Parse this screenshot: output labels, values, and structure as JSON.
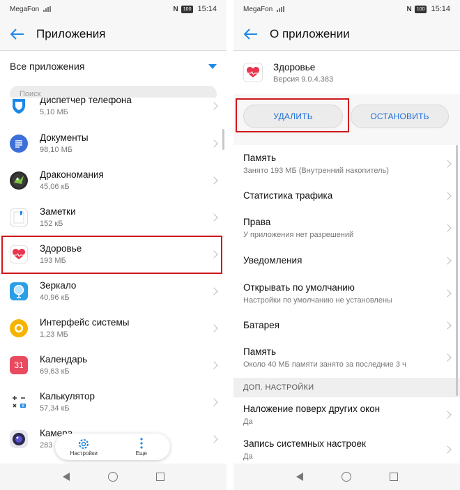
{
  "status": {
    "carrier": "MegaFon",
    "nfc": "N",
    "battery": "100",
    "time": "15:14"
  },
  "left": {
    "title": "Приложения",
    "filter": "Все приложения",
    "search_placeholder": "Поиск",
    "apps": [
      {
        "name": "Диспетчер телефона",
        "size": "5,10 МБ",
        "icon": "phone-manager-icon"
      },
      {
        "name": "Документы",
        "size": "98,10 МБ",
        "icon": "documents-icon"
      },
      {
        "name": "Дракономания",
        "size": "45,06 кБ",
        "icon": "dragon-game-icon"
      },
      {
        "name": "Заметки",
        "size": "152 кБ",
        "icon": "notes-icon"
      },
      {
        "name": "Здоровье",
        "size": "193 МБ",
        "icon": "health-heart-icon"
      },
      {
        "name": "Зеркало",
        "size": "40,96 кБ",
        "icon": "mirror-icon"
      },
      {
        "name": "Интерфейс системы",
        "size": "1,23 МБ",
        "icon": "system-ui-icon"
      },
      {
        "name": "Календарь",
        "size": "69,63 кБ",
        "icon": "calendar-icon",
        "badge": "31"
      },
      {
        "name": "Калькулятор",
        "size": "57,34 кБ",
        "icon": "calculator-icon"
      },
      {
        "name": "Камера",
        "size": "283",
        "icon": "camera-icon"
      }
    ],
    "fab": {
      "settings_label": "Настройки",
      "more_label": "Еще"
    }
  },
  "right": {
    "title": "О приложении",
    "app_name": "Здоровье",
    "version": "Версия 9.0.4.383",
    "uninstall": "УДАЛИТЬ",
    "stop": "ОСТАНОВИТЬ",
    "rows": [
      {
        "title": "Память",
        "sub": "Занято 193 МБ (Внутренний накопитель)"
      },
      {
        "title": "Статистика трафика",
        "sub": ""
      },
      {
        "title": "Права",
        "sub": "У приложения нет разрешений"
      },
      {
        "title": "Уведомления",
        "sub": ""
      },
      {
        "title": "Открывать по умолчанию",
        "sub": "Настройки по умолчанию не установлены"
      },
      {
        "title": "Батарея",
        "sub": ""
      },
      {
        "title": "Память",
        "sub": "Около 40 МБ памяти занято за последние 3 ч"
      }
    ],
    "section_label": "ДОП. НАСТРОЙКИ",
    "extra_rows": [
      {
        "title": "Наложение поверх других окон",
        "sub": "Да"
      },
      {
        "title": "Запись системных настроек",
        "sub": "Да"
      }
    ]
  },
  "colors": {
    "accent": "#1e88e5",
    "highlight": "#d0161b"
  }
}
